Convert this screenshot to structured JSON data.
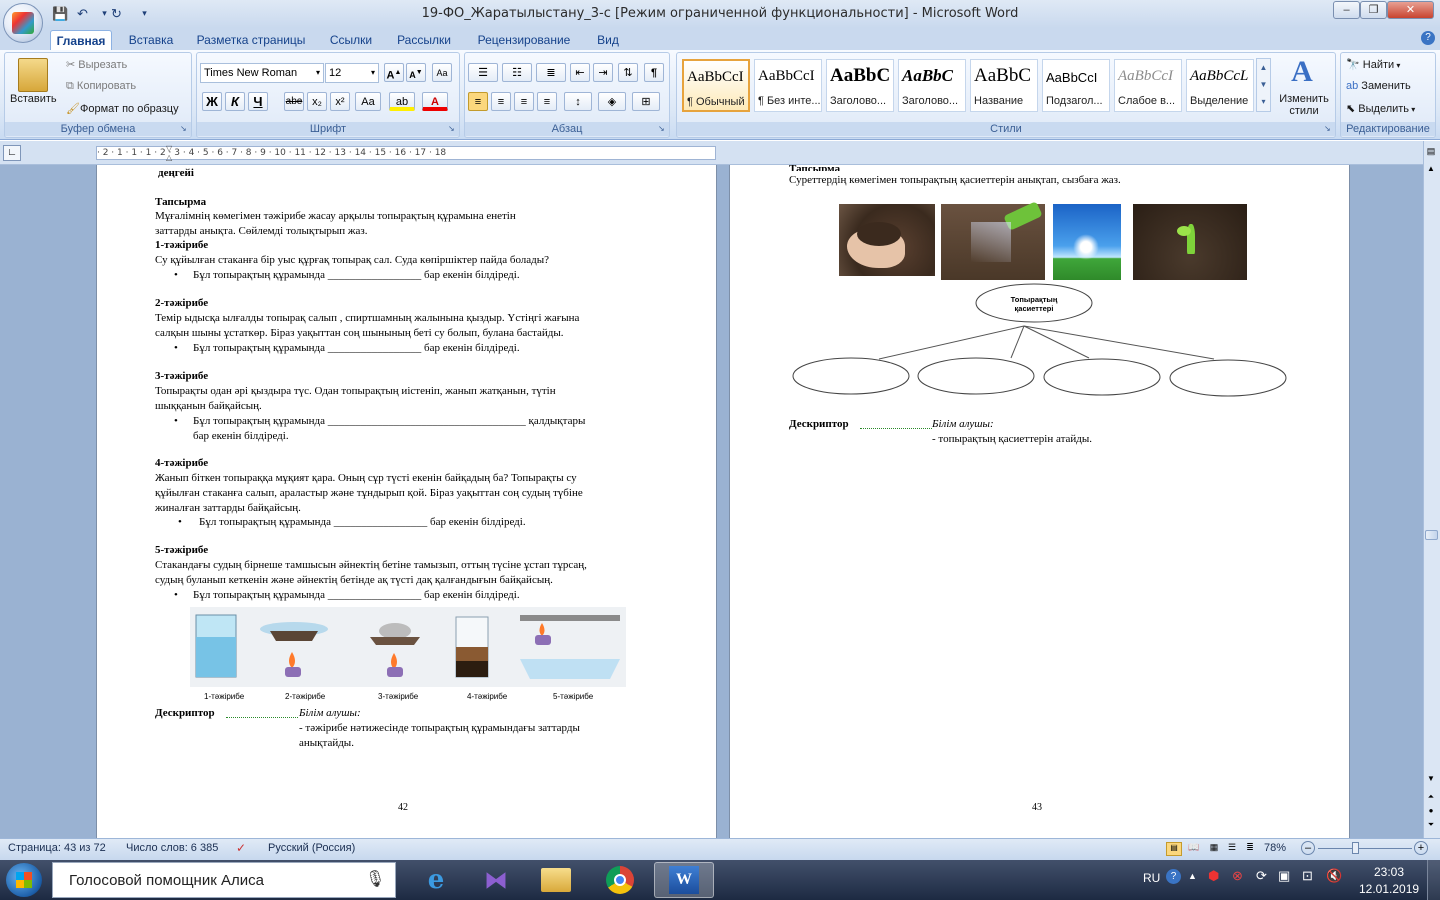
{
  "window": {
    "title": "19-ФО_Жаратылыстану_3-с [Режим ограниченной функциональности] - Microsoft Word",
    "min_label": "–",
    "max_label": "❐",
    "close_label": "✕"
  },
  "tabs": [
    "Главная",
    "Вставка",
    "Разметка страницы",
    "Ссылки",
    "Рассылки",
    "Рецензирование",
    "Вид"
  ],
  "clipboard": {
    "paste": "Вставить",
    "cut": "Вырезать",
    "copy": "Копировать",
    "format_painter": "Формат по образцу",
    "label": "Буфер обмена"
  },
  "font": {
    "name": "Times New Roman",
    "size": "12",
    "label": "Шрифт",
    "bold": "Ж",
    "italic": "К",
    "underline": "Ч",
    "strike": "abe",
    "sub": "x₂",
    "sup": "x²",
    "case": "Aa"
  },
  "paragraph": {
    "label": "Абзац"
  },
  "styles": {
    "label": "Стили",
    "items": [
      {
        "sample": "AaBbCcI",
        "name": "¶ Обычный"
      },
      {
        "sample": "AaBbCcI",
        "name": "¶ Без инте..."
      },
      {
        "sample": "AaBbC",
        "name": "Заголово..."
      },
      {
        "sample": "AaBbC",
        "name": "Заголово..."
      },
      {
        "sample": "AaBbC",
        "name": "Название"
      },
      {
        "sample": "AaBbCcI",
        "name": "Подзагол..."
      },
      {
        "sample": "AaBbCcI",
        "name": "Слабое в..."
      },
      {
        "sample": "AaBbCcL",
        "name": "Выделение"
      }
    ],
    "change": "Изменить стили"
  },
  "editing": {
    "find": "Найти",
    "replace": "Заменить",
    "select": "Выделить",
    "label": "Редактирование"
  },
  "ruler": "· 2 · 1 · 1 · 1 · 2 · 3 · 4 · 5 · 6 · 7 · 8 · 9 · 10 · 11 · 12 · 13 · 14 · 15 · 16 · 17 · 18",
  "page_left": {
    "level": "деңгейі",
    "task_title": "Тапсырма",
    "task_l1": "Мұғалімнің көмегімен тәжірибе жасау арқылы топырақтың құрамына енетін",
    "task_l2": "заттарды анықта. Сөйлемді толықтырып жаз.",
    "exp1_title": "1-тәжірибе",
    "exp1_l1": "Су құйылған стаканға бір уыс құрғақ топырақ сал. Суда көпіршіктер пайда болады?",
    "exp1_b1": "Бұл топырақтың құрамында _________________ бар екенін білдіреді.",
    "exp2_title": "2-тәжірибе",
    "exp2_l1": "Темір ыдысқа ылғалды топырақ салып , спиртшамның жалынына қыздыр. Үстіңгі жағына",
    "exp2_l2": "салқын шыны ұстаткөр. Біраз уақыттан соң шынының беті су болып, булана бастайды.",
    "exp2_b1": "Бұл топырақтың құрамында _________________ бар екенін білдіреді.",
    "exp3_title": "3-тәжірибе",
    "exp3_l1": "Топырақты одан әрі қыздыра түс. Одан топырақтың иістеніп, жанып жатқанын, түтін",
    "exp3_l2": "шыққанын байқайсың.",
    "exp3_b1": "Бұл топырақтың құрамында ____________________________________ қалдықтары",
    "exp3_b2": "бар екенін білдіреді.",
    "exp4_title": "4-тәжірибе",
    "exp4_l1": "Жанып біткен топыраққа мұқият қара. Оның сұр түсті екенін байқадың ба? Топырақты су",
    "exp4_l2": "құйылған стаканға салып, араластыр және тұндырып қой. Біраз уақыттан соң судың түбіне",
    "exp4_l3": "жиналған заттарды байқайсың.",
    "exp4_b1": "Бұл топырақтың құрамында _________________ бар екенін білдіреді.",
    "exp5_title": "5-тәжірибе",
    "exp5_l1": "Стакандағы судың бірнеше тамшысын әйнектің бетіне тамызып, оттың түсіне ұстап тұрсаң,",
    "exp5_l2": "судың буланып кеткенін және әйнектің бетінде ақ түсті дақ қалғандығын байқайсың.",
    "exp5_b1": "Бұл топырақтың құрамында _________________ бар екенін білдіреді.",
    "fig_labels": [
      "1-тәжірибе",
      "2-тәжірибе",
      "3-тәжірибе",
      "4-тәжірибе",
      "5-тәжірибе"
    ],
    "descriptor": "Дескриптор",
    "learner": "Білім алушы:",
    "desc_l1": "- тәжірибе нәтижесінде топырақтың құрамындағы заттарды",
    "desc_l2": "анықтайды.",
    "page_num": "42"
  },
  "page_right": {
    "task_title": "Тапсырма",
    "task_l1": "Суреттердің көмегімен топырақтың қасиеттерін анықтап, сызбаға жаз.",
    "oval_l1": "Топырақтың",
    "oval_l2": "қасиеттері",
    "descriptor": "Дескриптор",
    "learner": "Білім алушы:",
    "desc_l1": "- топырақтың қасиеттерін атайды.",
    "page_num": "43"
  },
  "status": {
    "page": "Страница: 43 из 72",
    "words": "Число слов: 6 385",
    "lang": "Русский (Россия)",
    "zoom": "78%"
  },
  "taskbar": {
    "assistant": "Голосовой помощник Алиса",
    "lang": "RU",
    "time": "23:03",
    "date": "12.01.2019"
  }
}
